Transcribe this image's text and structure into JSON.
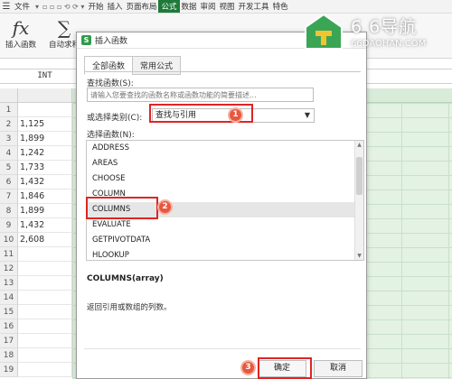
{
  "menubar": {
    "file": "文件",
    "items": [
      "开始",
      "插入",
      "页面布局",
      "公式",
      "数据",
      "审阅",
      "视图",
      "开发工具",
      "特色"
    ],
    "active": "公式"
  },
  "ribbon": {
    "insert_function_icon": "fx",
    "insert_function_label": "插入函数",
    "autosum_icon": "∑",
    "autosum_label": "自动求和"
  },
  "formula_bar": {
    "name_box": "INT"
  },
  "sheet": {
    "row_numbers": [
      "1",
      "2",
      "3",
      "4",
      "5",
      "6",
      "7",
      "8",
      "9",
      "10",
      "11",
      "12",
      "13",
      "14",
      "15",
      "16",
      "17",
      "18",
      "19"
    ],
    "col_a_values": [
      "",
      "1,125",
      "1,899",
      "1,242",
      "1,733",
      "1,432",
      "1,846",
      "1,899",
      "1,432",
      "2,608",
      "",
      "",
      "",
      "",
      "",
      "",
      "",
      "",
      ""
    ]
  },
  "dialog": {
    "title": "插入函数",
    "tabs": [
      "全部函数",
      "常用公式"
    ],
    "active_tab": "全部函数",
    "search_label": "查找函数(S):",
    "search_placeholder": "请输入您要查找的函数名称或函数功能的简要描述...",
    "category_label": "或选择类别(C):",
    "category_value": "查找与引用",
    "select_label": "选择函数(N):",
    "functions": [
      "ADDRESS",
      "AREAS",
      "CHOOSE",
      "COLUMN",
      "COLUMNS",
      "EVALUATE",
      "GETPIVOTDATA",
      "HLOOKUP"
    ],
    "selected_function": "COLUMNS",
    "signature": "COLUMNS(array)",
    "description": "返回引用或数组的列数。",
    "ok_label": "确定",
    "cancel_label": "取消"
  },
  "callouts": [
    "1",
    "2",
    "3"
  ],
  "watermark": {
    "title": "6 6导航",
    "subtitle": "66DAOHAN.COM"
  },
  "colors": {
    "accent": "#1f7a3a",
    "highlight": "#e02424",
    "step_badge": "#e8573f",
    "sheet_green": "#e3f2e3"
  }
}
